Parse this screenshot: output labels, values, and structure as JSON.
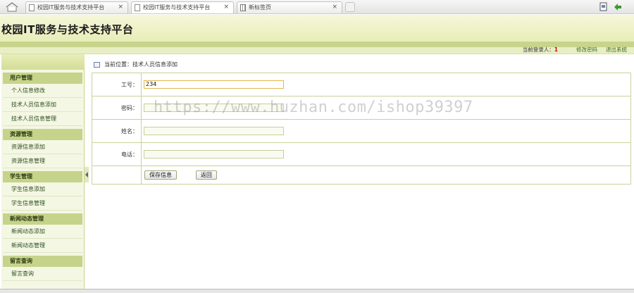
{
  "browser": {
    "tabs": [
      {
        "label": "校园IT服务与技术支持平台",
        "active": false
      },
      {
        "label": "校园IT服务与技术支持平台",
        "active": true
      },
      {
        "label": "新标签页",
        "active": false
      }
    ],
    "close_glyph": "×"
  },
  "header": {
    "title": "校园IT服务与技术支持平台"
  },
  "userbar": {
    "login_label": "当前登录人：",
    "login_user": "1",
    "change_password": "修改密码",
    "logout": "退出系统"
  },
  "sidebar": {
    "groups": [
      {
        "title": "用户管理",
        "items": [
          "个人信息修改",
          "技术人员信息添加",
          "技术人员信息管理"
        ]
      },
      {
        "title": "资源管理",
        "items": [
          "资源信息添加",
          "资源信息管理"
        ]
      },
      {
        "title": "学生管理",
        "items": [
          "学生信息添加",
          "学生信息管理"
        ]
      },
      {
        "title": "新闻动态管理",
        "items": [
          "新闻动态添加",
          "新闻动态管理"
        ]
      },
      {
        "title": "留言查询",
        "items": [
          "留言查询"
        ]
      }
    ]
  },
  "breadcrumb": {
    "text": "当前位置：技术人员信息添加"
  },
  "form": {
    "fields": [
      {
        "label": "工号：",
        "value": "234"
      },
      {
        "label": "密码：",
        "value": ""
      },
      {
        "label": "姓名：",
        "value": ""
      },
      {
        "label": "电话：",
        "value": ""
      }
    ],
    "save_label": "保存信息",
    "back_label": "返回"
  },
  "watermark": "https://www.huzhan.com/ishop39397",
  "colors": {
    "header_bg": "#eef2c8",
    "band": "#c8d48c",
    "group_head": "#c6d38a",
    "accent_red": "#cc0000"
  }
}
